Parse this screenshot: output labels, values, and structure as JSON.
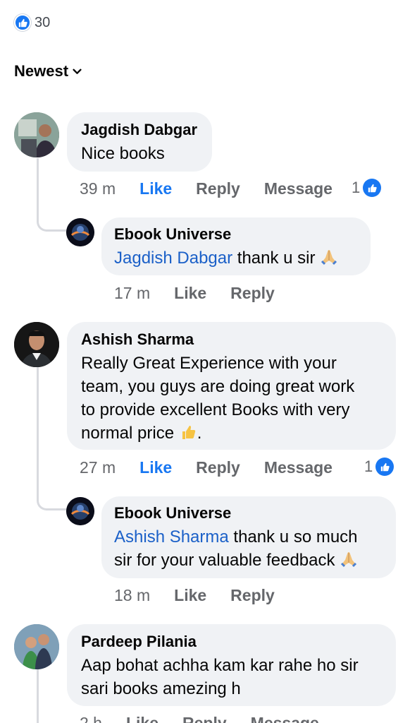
{
  "reactions_summary": {
    "icon": "like-icon",
    "count": "30"
  },
  "sort": {
    "label": "Newest",
    "icon": "chevron-down-icon"
  },
  "comments": [
    {
      "author": "Jagdish Dabgar",
      "text": "Nice books",
      "time": "39 m",
      "like": "Like",
      "reply": "Reply",
      "message": "Message",
      "reaction_count": "1",
      "liked": true,
      "replies": [
        {
          "author": "Ebook Universe",
          "mention": "Jagdish Dabgar",
          "text": " thank u sir ",
          "emoji": "folded-hands-emoji",
          "time": "17 m",
          "like": "Like",
          "reply": "Reply"
        }
      ]
    },
    {
      "author": "Ashish Sharma",
      "text_lines": [
        "Really Great Experience with your",
        "team, you guys are doing great work",
        "to provide excellent Books with very",
        "normal price "
      ],
      "text_end": ".",
      "emoji": "thumbs-up-emoji",
      "time": "27 m",
      "like": "Like",
      "reply": "Reply",
      "message": "Message",
      "reaction_count": "1",
      "liked": true,
      "replies": [
        {
          "author": "Ebook Universe",
          "mention": "Ashish Sharma",
          "text_line1": " thank u so much",
          "text_line2": "sir for your valuable feedback ",
          "emoji": "folded-hands-emoji",
          "time": "18 m",
          "like": "Like",
          "reply": "Reply"
        }
      ]
    },
    {
      "author": "Pardeep Pilania",
      "text_lines": [
        "Aap bohat achha kam kar rahe ho sir",
        "sari books amezing h"
      ],
      "time": "2 h",
      "like": "Like",
      "reply": "Reply",
      "message": "Message"
    }
  ],
  "colors": {
    "like_blue": "#1877f2",
    "mention_blue": "#1b60c8",
    "bubble_bg": "#f0f2f5",
    "meta_gray": "#65676b"
  }
}
